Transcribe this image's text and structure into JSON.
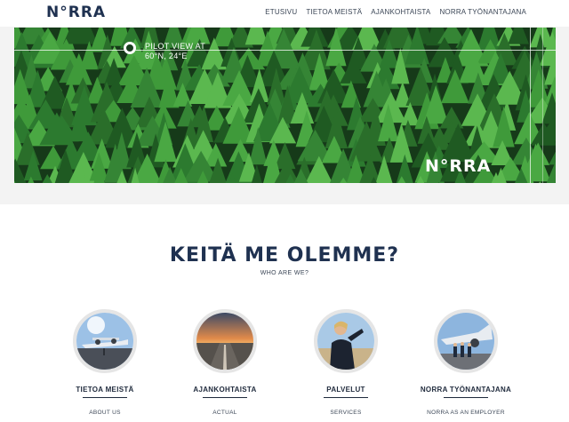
{
  "header": {
    "logo": "N°RRA",
    "nav": [
      "ETUSIVU",
      "TIETOA MEISTÄ",
      "AJANKOHTAISTA",
      "NORRA TYÖNANTAJANA"
    ]
  },
  "hero": {
    "pilot_line1": "PILOT VIEW AT",
    "pilot_line2": "60°N, 24°E",
    "logo": "N°RRA"
  },
  "about": {
    "title": "KEITÄ ME OLEMME?",
    "subtitle": "WHO ARE WE?"
  },
  "cards": [
    {
      "title": "TIETOA MEISTÄ",
      "sub": "ABOUT US"
    },
    {
      "title": "AJANKOHTAISTA",
      "sub": "ACTUAL"
    },
    {
      "title": "PALVELUT",
      "sub": "SERVICES"
    },
    {
      "title": "NORRA TYÖNANTAJANA",
      "sub": "NORRA AS AN EMPLOYER"
    }
  ],
  "colors": {
    "navy": "#1f3150",
    "forest": "#2e7a2c"
  }
}
